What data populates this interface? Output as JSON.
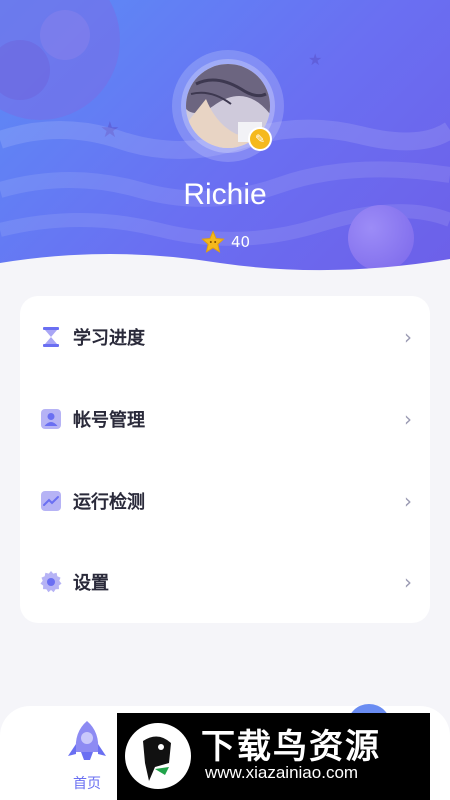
{
  "profile": {
    "username": "Richie",
    "stars": "40"
  },
  "menu": {
    "items": [
      {
        "label": "学习进度",
        "icon": "hourglass-icon"
      },
      {
        "label": "帐号管理",
        "icon": "user-card-icon"
      },
      {
        "label": "运行检测",
        "icon": "chart-line-icon"
      },
      {
        "label": "设置",
        "icon": "gear-icon"
      }
    ]
  },
  "tabbar": {
    "home_label": "首页"
  },
  "watermark": {
    "title": "下载鸟资源",
    "url": "www.xiazainiao.com"
  },
  "colors": {
    "accent": "#6a6ff2",
    "star": "#f5b91d"
  }
}
